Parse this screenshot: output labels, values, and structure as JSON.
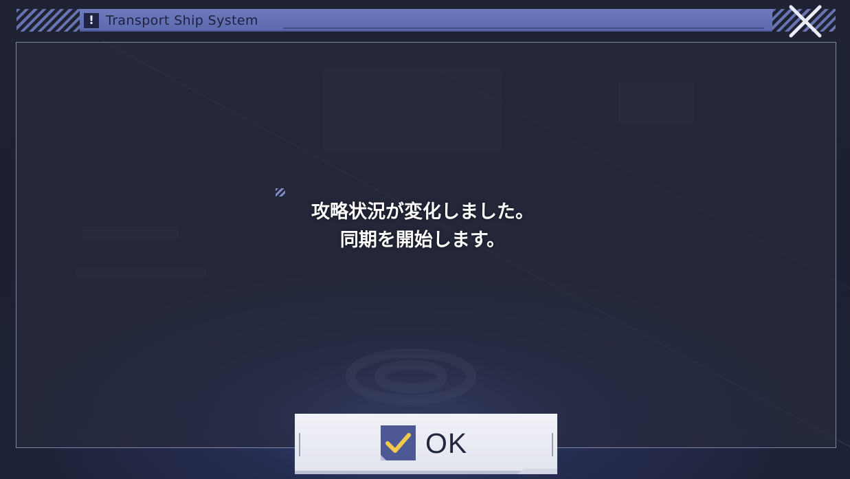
{
  "header": {
    "title": "Transport Ship System",
    "alert_icon": "exclamation-icon",
    "alert_glyph": "!"
  },
  "close": {
    "icon": "close-icon"
  },
  "dialog": {
    "message_lines": [
      "攻略状況が変化しました。",
      "同期を開始します。"
    ]
  },
  "ok_button": {
    "label": "OK",
    "icon": "checkbox-check-icon"
  },
  "colors": {
    "accent": "#6d7bbd",
    "check_yellow": "#f2c94c",
    "check_box": "#4e5894",
    "panel_border": "#7e86a8"
  }
}
